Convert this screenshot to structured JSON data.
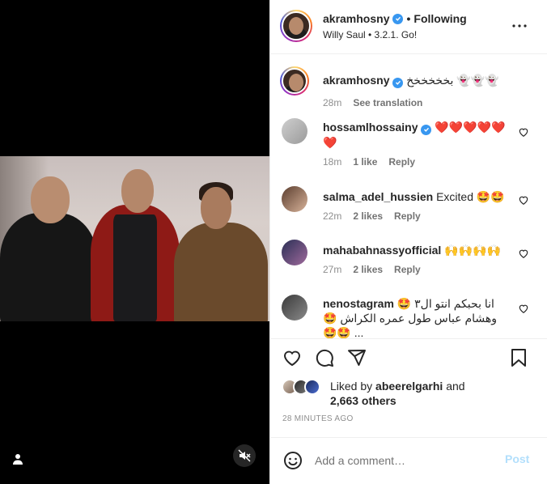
{
  "header": {
    "username": "akramhosny",
    "separator": "•",
    "follow_state": "Following",
    "subtitle": "Willy Saul • 3.2.1. Go!"
  },
  "caption": {
    "username": "akramhosny",
    "text": "بخخخخخخ 👻👻👻",
    "time": "28m",
    "see_translation": "See translation"
  },
  "comments": [
    {
      "username": "hossamlhossainy",
      "text": "❤️❤️❤️❤️❤️ ❤️",
      "time": "18m",
      "likes": "1 like",
      "reply": "Reply"
    },
    {
      "username": "salma_adel_hussien",
      "text": "Excited 🤩🤩",
      "time": "22m",
      "likes": "2 likes",
      "reply": "Reply"
    },
    {
      "username": "mahabahnassyofficial",
      "text": "🙌🙌🙌🙌",
      "time": "27m",
      "likes": "2 likes",
      "reply": "Reply"
    },
    {
      "username": "nenostagram",
      "text_line1": "🤩 انا بحبكم انتو ال٣",
      "text_line2": "🤩 وهشام عباس طول عمره الكراش",
      "text_line3": "🤩🤩 ..."
    }
  ],
  "likes": {
    "prefix": "Liked by",
    "user": "abeerelgarhi",
    "and": "and",
    "others": "2,663 others"
  },
  "time_ago": "28 MINUTES AGO",
  "add_comment": {
    "placeholder": "Add a comment…",
    "post_label": "Post"
  },
  "colors": {
    "verified": "#3897f0",
    "post_disabled": "#b2dffc",
    "heart": "#ed4956"
  }
}
